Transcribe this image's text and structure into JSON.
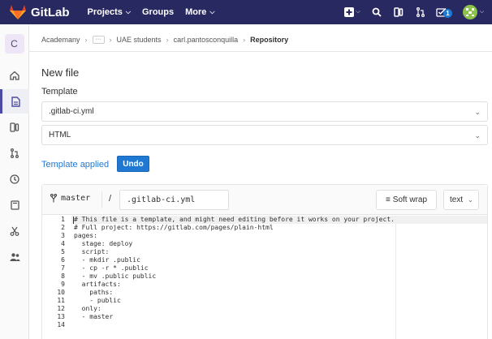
{
  "navbar": {
    "logo_text": "GitLab",
    "links": [
      {
        "label": "Projects",
        "chevron": true
      },
      {
        "label": "Groups",
        "chevron": false
      },
      {
        "label": "More",
        "chevron": true
      }
    ],
    "todo_count": "1",
    "brand_color": "#292961"
  },
  "sidebar": {
    "avatar_letter": "C",
    "active_color": "#4b4ba3"
  },
  "breadcrumb": {
    "items": [
      "Academany",
      "UAE students",
      "carl.pantosconquilla"
    ],
    "current": "Repository"
  },
  "page": {
    "title": "New file",
    "template_label": "Template",
    "template_file": ".gitlab-ci.yml",
    "template_type": "HTML",
    "template_applied": "Template applied",
    "undo_label": "Undo"
  },
  "editor": {
    "branch": "master",
    "slash": "/",
    "file_name": ".gitlab-ci.yml",
    "soft_wrap_label": "Soft wrap",
    "mode_label": "text",
    "lines": [
      {
        "n": "1",
        "text": "# This file is a template, and might need editing before it works on your project."
      },
      {
        "n": "2",
        "text": "# Full project: https://gitlab.com/pages/plain-html"
      },
      {
        "n": "3",
        "text": "pages:"
      },
      {
        "n": "4",
        "text": "  stage: deploy"
      },
      {
        "n": "5",
        "text": "  script:"
      },
      {
        "n": "6",
        "text": "  - mkdir .public"
      },
      {
        "n": "7",
        "text": "  - cp -r * .public"
      },
      {
        "n": "8",
        "text": "  - mv .public public"
      },
      {
        "n": "9",
        "text": "  artifacts:"
      },
      {
        "n": "10",
        "text": "    paths:"
      },
      {
        "n": "11",
        "text": "    - public"
      },
      {
        "n": "12",
        "text": "  only:"
      },
      {
        "n": "13",
        "text": "  - master"
      },
      {
        "n": "14",
        "text": ""
      }
    ]
  },
  "colors": {
    "link_blue": "#1f78d1"
  }
}
